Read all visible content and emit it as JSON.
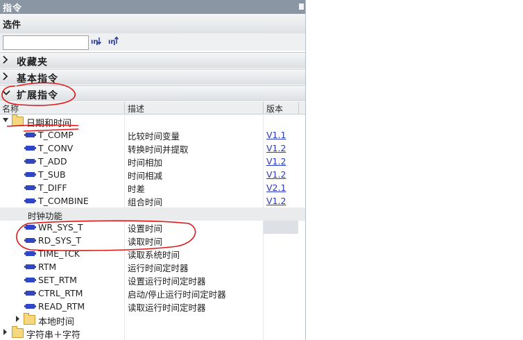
{
  "title": "指令",
  "options_label": "选件",
  "search": {
    "value": "",
    "placeholder": ""
  },
  "toolbar": {
    "btn1": "ꟷ",
    "btn2": "ꟷ"
  },
  "categories": [
    {
      "label": "收藏夹",
      "expanded": false
    },
    {
      "label": "基本指令",
      "expanded": false
    },
    {
      "label": "扩展指令",
      "expanded": true
    }
  ],
  "columns": {
    "name": "名称",
    "desc": "描述",
    "version": "版本"
  },
  "folder_datetime": "日期和时间",
  "items_datetime": [
    {
      "name": "T_COMP",
      "desc": "比较时间变量",
      "ver": "V1.1"
    },
    {
      "name": "T_CONV",
      "desc": "转换时间并提取",
      "ver": "V1.2"
    },
    {
      "name": "T_ADD",
      "desc": "时间相加",
      "ver": "V1.2"
    },
    {
      "name": "T_SUB",
      "desc": "时间相减",
      "ver": "V1.2"
    },
    {
      "name": "T_DIFF",
      "desc": "时差",
      "ver": "V2.1"
    },
    {
      "name": "T_COMBINE",
      "desc": "组合时间",
      "ver": "V1.2"
    }
  ],
  "group_clock": "时钟功能",
  "items_clock": [
    {
      "name": "WR_SYS_T",
      "desc": "设置时间"
    },
    {
      "name": "RD_SYS_T",
      "desc": "读取时间"
    },
    {
      "name": "TIME_TCK",
      "desc": "读取系统时间"
    },
    {
      "name": "RTM",
      "desc": "运行时间定时器"
    },
    {
      "name": "SET_RTM",
      "desc": "设置运行时间定时器"
    },
    {
      "name": "CTRL_RTM",
      "desc": "启动/停止运行时间定时器"
    },
    {
      "name": "READ_RTM",
      "desc": "读取运行时间定时器"
    }
  ],
  "folder_localtime": "本地时间",
  "folder_string": "字符串＋字符",
  "colors": {
    "titlebar": "#8a96a3",
    "link": "#2a39c4",
    "block_icon": "#2f46c6",
    "annotation": "#e01818"
  }
}
